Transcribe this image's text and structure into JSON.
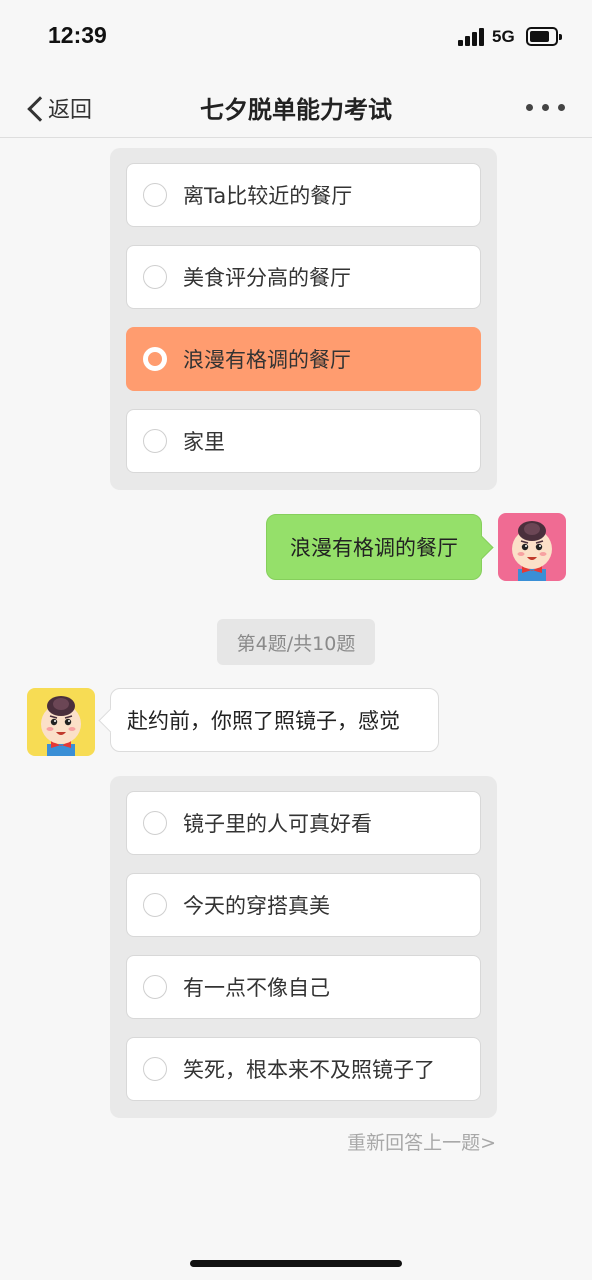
{
  "status_bar": {
    "time": "12:39",
    "network": "5G"
  },
  "nav": {
    "back_label": "返回",
    "title": "七夕脱单能力考试"
  },
  "question3": {
    "options": [
      {
        "label": "离Ta比较近的餐厅",
        "selected": false
      },
      {
        "label": "美食评分高的餐厅",
        "selected": false
      },
      {
        "label": "浪漫有格调的餐厅",
        "selected": true
      },
      {
        "label": "家里",
        "selected": false
      }
    ],
    "user_answer": "浪漫有格调的餐厅"
  },
  "progress": "第4题/共10题",
  "question4": {
    "prompt": "赴约前，你照了照镜子，感觉",
    "options": [
      {
        "label": "镜子里的人可真好看",
        "selected": false
      },
      {
        "label": "今天的穿搭真美",
        "selected": false
      },
      {
        "label": "有一点不像自己",
        "selected": false
      },
      {
        "label": "笑死，根本来不及照镜子了",
        "selected": false
      }
    ]
  },
  "redo_link": "重新回答上一题>",
  "colors": {
    "selected_option": "#ff9c6f",
    "user_bubble": "#95e06a",
    "user_avatar_bg": "#f06b93",
    "bot_avatar_bg": "#f7dc54"
  },
  "icons": {
    "back": "chevron-left-icon",
    "more": "more-dots-icon"
  }
}
